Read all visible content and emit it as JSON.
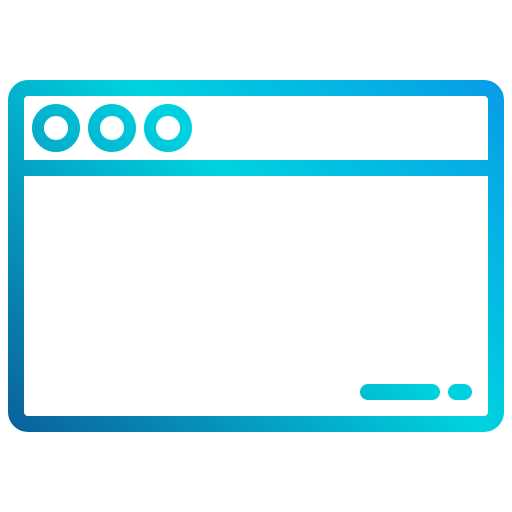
{
  "icon": {
    "name": "browser-window-icon",
    "colors": {
      "gradient_start": "#0d4a8f",
      "gradient_mid": "#00d2e0",
      "gradient_end": "#0a8fe8",
      "background": "#ffffff"
    }
  },
  "titlebar": {
    "window_controls": [
      {
        "name": "close-dot-icon"
      },
      {
        "name": "minimize-dot-icon"
      },
      {
        "name": "maximize-dot-icon"
      }
    ]
  },
  "content": {
    "footer_elements": [
      {
        "name": "progress-bar"
      },
      {
        "name": "small-indicator"
      }
    ]
  }
}
